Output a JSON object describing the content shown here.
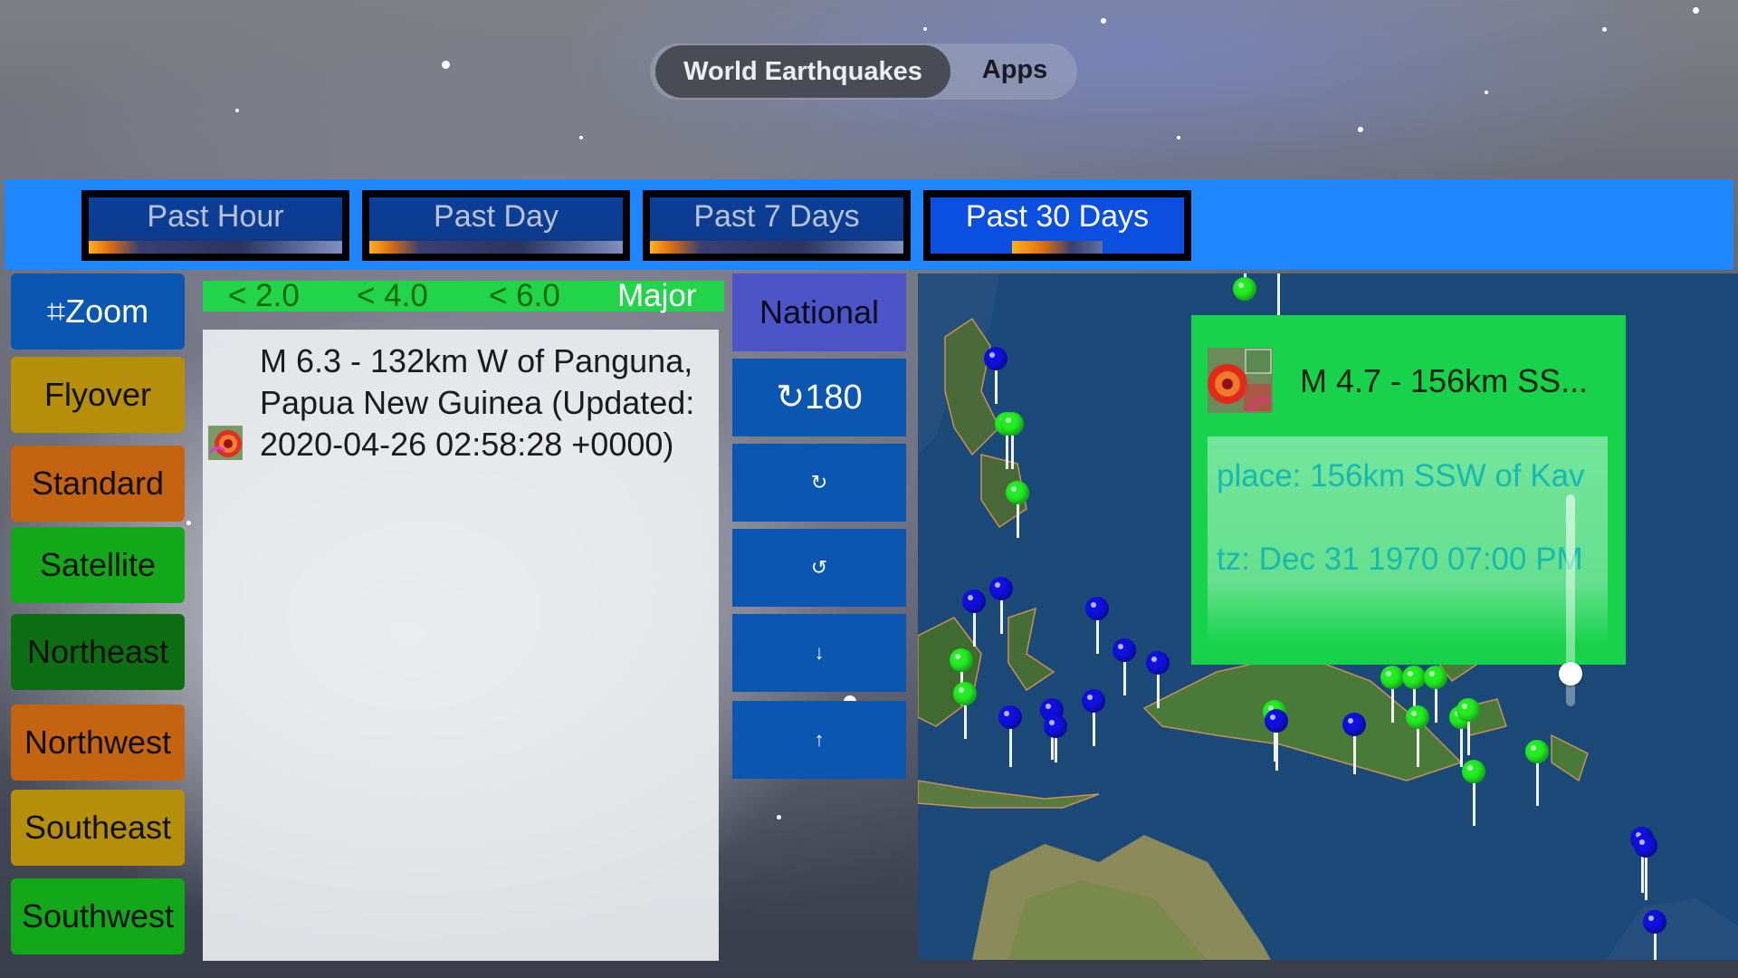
{
  "top_nav": {
    "tabs": [
      {
        "label": "World Earthquakes",
        "selected": true
      },
      {
        "label": "Apps",
        "selected": false
      }
    ]
  },
  "time_ranges": [
    {
      "label": "Past Hour",
      "selected": false
    },
    {
      "label": "Past Day",
      "selected": false
    },
    {
      "label": "Past 7 Days",
      "selected": false
    },
    {
      "label": "Past 30 Days",
      "selected": true
    }
  ],
  "map_controls": [
    {
      "label": "⌗Zoom",
      "color": "#0a56b0",
      "text_color": "#ffffff"
    },
    {
      "label": "Flyover",
      "color": "#b58f0a",
      "text_color": "#101010"
    },
    {
      "label": "Standard",
      "color": "#c56410",
      "text_color": "#101010"
    },
    {
      "label": "Satellite",
      "color": "#12a81a",
      "text_color": "#101010"
    },
    {
      "label": "Northeast",
      "color": "#0e6e14",
      "text_color": "#101010"
    },
    {
      "label": "Northwest",
      "color": "#c56410",
      "text_color": "#101010"
    },
    {
      "label": "Southeast",
      "color": "#b58f0a",
      "text_color": "#101010"
    },
    {
      "label": "Southwest",
      "color": "#12a81a",
      "text_color": "#101010"
    }
  ],
  "magnitude_legend": [
    "< 2.0",
    "< 4.0",
    "< 6.0",
    "Major"
  ],
  "quake_list": {
    "items": [
      {
        "text": "M 6.3 - 132km W of Panguna, Papua New Guinea (Updated: 2020-04-26 02:58:28 +0000)",
        "icon": "storm-radar-icon"
      }
    ]
  },
  "side_controls": {
    "national_label": "National",
    "rotate_label": "↻180",
    "rotate_cw_symbol": "↻",
    "rotate_ccw_symbol": "↺",
    "down_symbol": "↓",
    "up_symbol": "↑"
  },
  "callout": {
    "title": "M 4.7 - 156km SS...",
    "place": "place: 156km SSW of Kav",
    "tz": "tz: Dec 31 1970 07:00 PM"
  },
  "colors": {
    "accent_blue": "#1e86ff",
    "magnitude_low": "#22ee22",
    "magnitude_mid": "#1010e0"
  }
}
